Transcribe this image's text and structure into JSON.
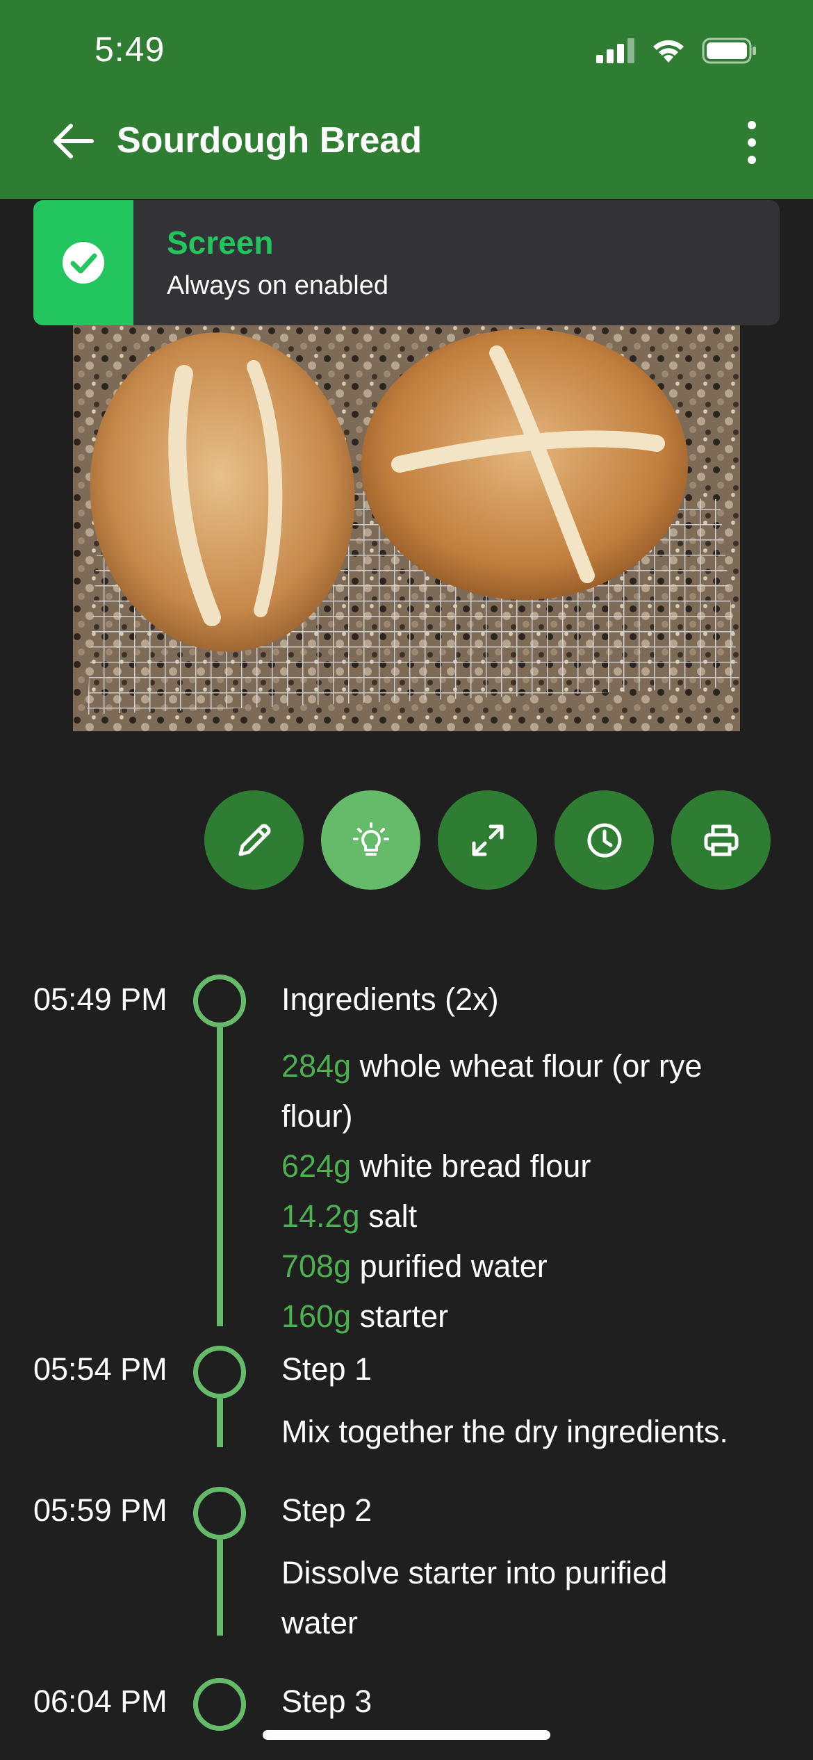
{
  "status_bar": {
    "time": "5:49"
  },
  "app_bar": {
    "title": "Sourdough Bread"
  },
  "toast": {
    "title": "Screen",
    "message": "Always on enabled"
  },
  "actions": [
    {
      "icon": "pencil-icon",
      "active": false
    },
    {
      "icon": "lightbulb-icon",
      "active": true
    },
    {
      "icon": "expand-icon",
      "active": false
    },
    {
      "icon": "clock-icon",
      "active": false
    },
    {
      "icon": "printer-icon",
      "active": false
    }
  ],
  "timeline": [
    {
      "time": "05:49 PM",
      "heading": "Ingredients (2x)",
      "ingredients": [
        {
          "qty": "284g",
          "name": "whole wheat flour (or rye flour)"
        },
        {
          "qty": "624g",
          "name": "white bread flour"
        },
        {
          "qty": "14.2g",
          "name": "salt"
        },
        {
          "qty": "708g",
          "name": "purified water"
        },
        {
          "qty": "160g",
          "name": "starter"
        }
      ]
    },
    {
      "time": "05:54 PM",
      "heading": "Step 1",
      "text": "Mix together the dry ingredients."
    },
    {
      "time": "05:59 PM",
      "heading": "Step 2",
      "text": "Dissolve starter into purified water"
    },
    {
      "time": "06:04 PM",
      "heading": "Step 3"
    }
  ],
  "colors": {
    "app_bar": "#2e7d32",
    "accent": "#66bb6a",
    "quantity": "#4caf50",
    "toast_accent": "#22c55e",
    "background": "#1f1f1f"
  }
}
